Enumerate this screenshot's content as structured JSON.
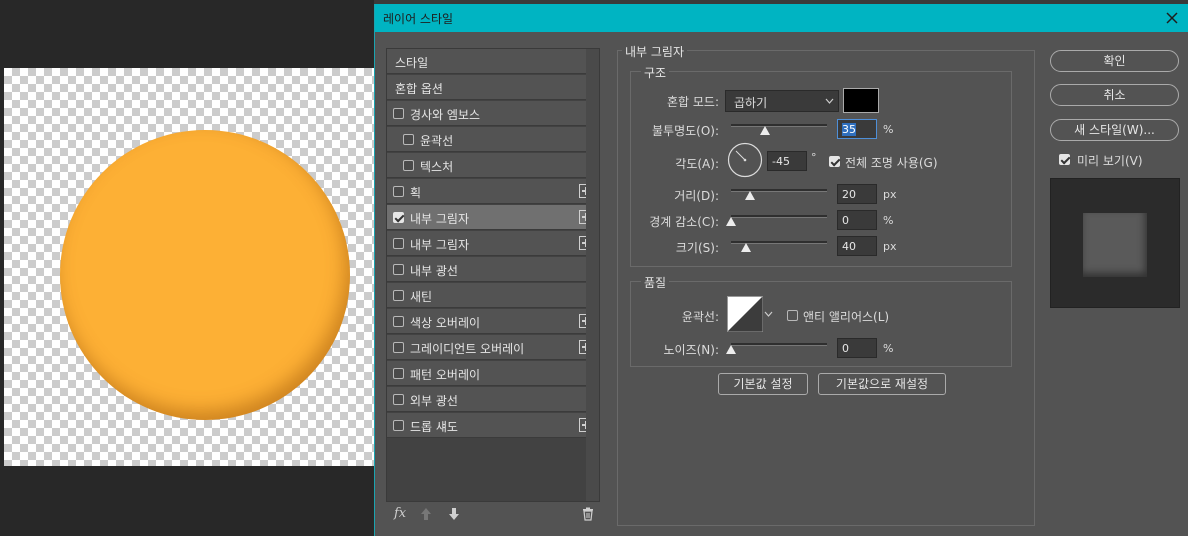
{
  "dialog": {
    "title": "레이어 스타일",
    "close_icon": "close-icon"
  },
  "style_list": {
    "items": [
      {
        "label": "스타일",
        "checkbox": false,
        "plus": false,
        "checked": false,
        "indent": 0
      },
      {
        "label": "혼합 옵션",
        "checkbox": false,
        "plus": false,
        "checked": false,
        "indent": 0
      },
      {
        "label": "경사와 엠보스",
        "checkbox": true,
        "plus": false,
        "checked": false,
        "indent": 0
      },
      {
        "label": "윤곽선",
        "checkbox": true,
        "plus": false,
        "checked": false,
        "indent": 1
      },
      {
        "label": "텍스처",
        "checkbox": true,
        "plus": false,
        "checked": false,
        "indent": 1
      },
      {
        "label": "획",
        "checkbox": true,
        "plus": true,
        "checked": false,
        "indent": 0
      },
      {
        "label": "내부 그림자",
        "checkbox": true,
        "plus": true,
        "checked": true,
        "indent": 0,
        "selected": true
      },
      {
        "label": "내부 그림자",
        "checkbox": true,
        "plus": true,
        "checked": false,
        "indent": 0
      },
      {
        "label": "내부 광선",
        "checkbox": true,
        "plus": false,
        "checked": false,
        "indent": 0
      },
      {
        "label": "새틴",
        "checkbox": true,
        "plus": false,
        "checked": false,
        "indent": 0
      },
      {
        "label": "색상 오버레이",
        "checkbox": true,
        "plus": true,
        "checked": false,
        "indent": 0
      },
      {
        "label": "그레이디언트 오버레이",
        "checkbox": true,
        "plus": true,
        "checked": false,
        "indent": 0
      },
      {
        "label": "패턴 오버레이",
        "checkbox": true,
        "plus": false,
        "checked": false,
        "indent": 0
      },
      {
        "label": "외부 광선",
        "checkbox": true,
        "plus": false,
        "checked": false,
        "indent": 0
      },
      {
        "label": "드롭 섀도",
        "checkbox": true,
        "plus": true,
        "checked": false,
        "indent": 0
      }
    ],
    "footer": {
      "fx_label": "fx",
      "up_icon": "arrow-up-icon",
      "down_icon": "arrow-down-icon",
      "trash_icon": "trash-icon"
    }
  },
  "inner_shadow": {
    "section_title": "내부 그림자",
    "structure": {
      "title": "구조",
      "blend_mode_label": "혼합 모드:",
      "blend_mode_value": "곱하기",
      "shadow_color": "#000000",
      "opacity_label": "불투명도(O):",
      "opacity_value": "35",
      "opacity_unit": "%",
      "angle_label": "각도(A):",
      "angle_value": "-45",
      "angle_unit": "°",
      "global_light_label": "전체 조명 사용(G)",
      "global_light_checked": true,
      "distance_label": "거리(D):",
      "distance_value": "20",
      "distance_unit": "px",
      "choke_label": "경계 감소(C):",
      "choke_value": "0",
      "choke_unit": "%",
      "size_label": "크기(S):",
      "size_value": "40",
      "size_unit": "px"
    },
    "quality": {
      "title": "품질",
      "contour_label": "윤곽선:",
      "anti_alias_label": "앤티 앨리어스(L)",
      "anti_alias_checked": false,
      "noise_label": "노이즈(N):",
      "noise_value": "0",
      "noise_unit": "%"
    },
    "make_default_label": "기본값 설정",
    "reset_default_label": "기본값으로 재설정"
  },
  "right_panel": {
    "ok_label": "확인",
    "cancel_label": "취소",
    "new_style_label": "새 스타일(W)...",
    "preview_label": "미리 보기(V)",
    "preview_checked": true
  },
  "canvas": {
    "circle_color": "#fdb035"
  }
}
